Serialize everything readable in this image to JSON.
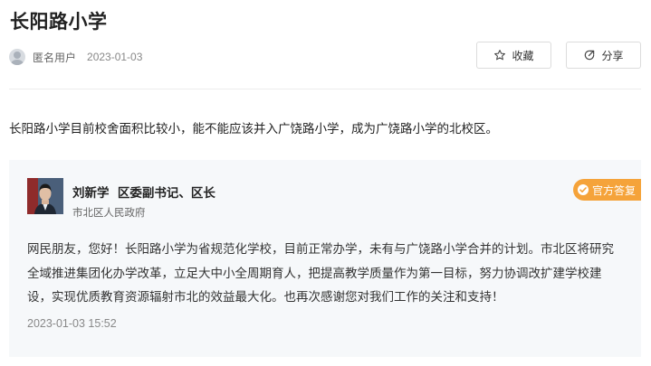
{
  "page": {
    "title": "长阳路小学",
    "author": "匿名用户",
    "date": "2023-01-03"
  },
  "actions": {
    "favorite_label": "收藏",
    "share_label": "分享"
  },
  "question": {
    "text": "长阳路小学目前校舍面积比较小，能不能应该并入广饶路小学，成为广饶路小学的北校区。"
  },
  "answer": {
    "official_name": "刘新学",
    "official_title": "区委副书记、区长",
    "department": "市北区人民政府",
    "badge": "官方答复",
    "text": "网民朋友，您好！长阳路小学为省规范化学校，目前正常办学，未有与广饶路小学合并的计划。市北区将研究全域推进集团化办学改革，立足大中小全周期育人，把提高教学质量作为第一目标，努力协调改扩建学校建设，实现优质教育资源辐射市北的效益最大化。也再次感谢您对我们工作的关注和支持！",
    "time": "2023-01-03 15:52"
  },
  "colors": {
    "badge": "#f5a33a",
    "answer_bg": "#f6f8fa"
  },
  "icons": {
    "favorite": "star-icon",
    "share": "share-icon",
    "badge": "official-icon"
  }
}
